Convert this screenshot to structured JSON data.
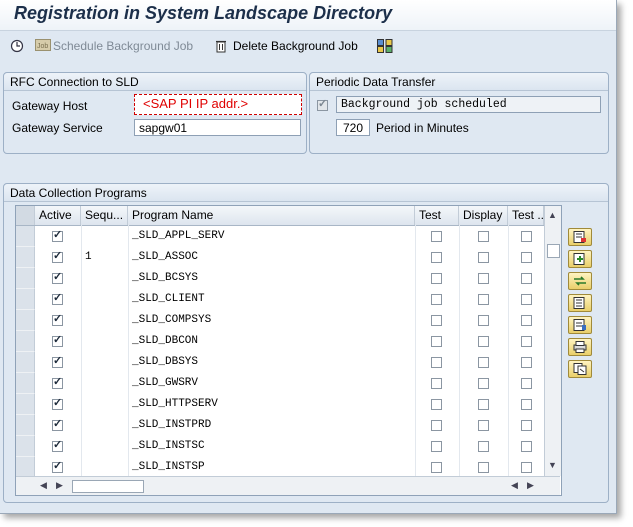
{
  "window": {
    "title": "Registration in System Landscape Directory"
  },
  "toolbar": {
    "schedule_label": "Schedule Background Job",
    "delete_label": "Delete Background Job"
  },
  "rfc": {
    "title": "RFC Connection to SLD",
    "gateway_host_label": "Gateway Host",
    "gateway_host_value": "<SAP PI IP addr.>",
    "gateway_service_label": "Gateway Service",
    "gateway_service_value": "sapgw01"
  },
  "periodic": {
    "title": "Periodic Data Transfer",
    "status_value": "Background job scheduled",
    "period_value": "720",
    "period_label": "Period in Minutes"
  },
  "programs": {
    "title": "Data Collection Programs",
    "columns": [
      "Active",
      "Sequ...",
      "Program Name",
      "Test",
      "Display",
      "Test ..."
    ],
    "rows": [
      {
        "active": true,
        "seq": "",
        "name": "_SLD_APPL_SERV"
      },
      {
        "active": true,
        "seq": "1",
        "name": "_SLD_ASSOC"
      },
      {
        "active": true,
        "seq": "",
        "name": "_SLD_BCSYS"
      },
      {
        "active": true,
        "seq": "",
        "name": "_SLD_CLIENT"
      },
      {
        "active": true,
        "seq": "",
        "name": "_SLD_COMPSYS"
      },
      {
        "active": true,
        "seq": "",
        "name": "_SLD_DBCON"
      },
      {
        "active": true,
        "seq": "",
        "name": "_SLD_DBSYS"
      },
      {
        "active": true,
        "seq": "",
        "name": "_SLD_GWSRV"
      },
      {
        "active": true,
        "seq": "",
        "name": "_SLD_HTTPSERV"
      },
      {
        "active": true,
        "seq": "",
        "name": "_SLD_INSTPRD"
      },
      {
        "active": true,
        "seq": "",
        "name": "_SLD_INSTSC"
      },
      {
        "active": true,
        "seq": "",
        "name": "_SLD_INSTSP"
      }
    ],
    "side_buttons": [
      "details-icon",
      "insert-row-icon",
      "move-icon",
      "sort-icon",
      "detail-view-icon",
      "print-icon",
      "copy-icon"
    ]
  }
}
